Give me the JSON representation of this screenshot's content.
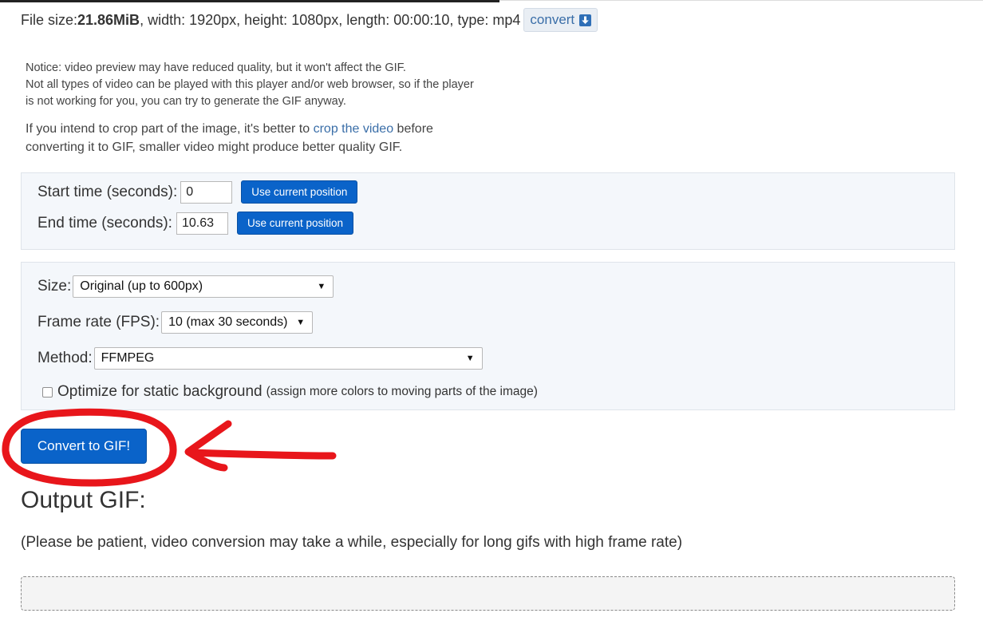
{
  "file_info": {
    "size_label": "File size: ",
    "size_value": "21.86MiB",
    "details": ", width: 1920px, height: 1080px, length: 00:00:10, type: mp4",
    "convert_label": "convert",
    "convert_icon": "download-arrow-icon"
  },
  "notice": {
    "line1": "Notice: video preview may have reduced quality, but it won't affect the GIF.",
    "line2": "Not all types of video can be played with this player and/or web browser, so if the player",
    "line3": "is not working for you, you can try to generate the GIF anyway."
  },
  "crop_tip": {
    "before": "If you intend to crop part of the image, it's better to ",
    "link": "crop the video",
    "after": " before",
    "line2": "converting it to GIF, smaller video might produce better quality GIF."
  },
  "time": {
    "start_label": "Start time (seconds):",
    "start_value": "0",
    "end_label": "End time (seconds):",
    "end_value": "10.63",
    "use_current_label": "Use current position"
  },
  "options": {
    "size_label": "Size:",
    "size_value": "Original (up to 600px)",
    "fps_label": "Frame rate (FPS):",
    "fps_value": "10 (max 30 seconds)",
    "method_label": "Method:",
    "method_value": "FFMPEG",
    "optimize_label": "Optimize for static background",
    "optimize_hint": "(assign more colors to moving parts of the image)",
    "optimize_checked": false
  },
  "convert_button": "Convert to GIF!",
  "output": {
    "title": "Output GIF:",
    "note": "(Please be patient, video conversion may take a while, especially for long gifs with high frame rate)"
  },
  "colors": {
    "primary_button": "#0a63c9",
    "link": "#3a6ea8",
    "panel_bg": "#f4f7fb",
    "annotation_red": "#e8161b"
  }
}
